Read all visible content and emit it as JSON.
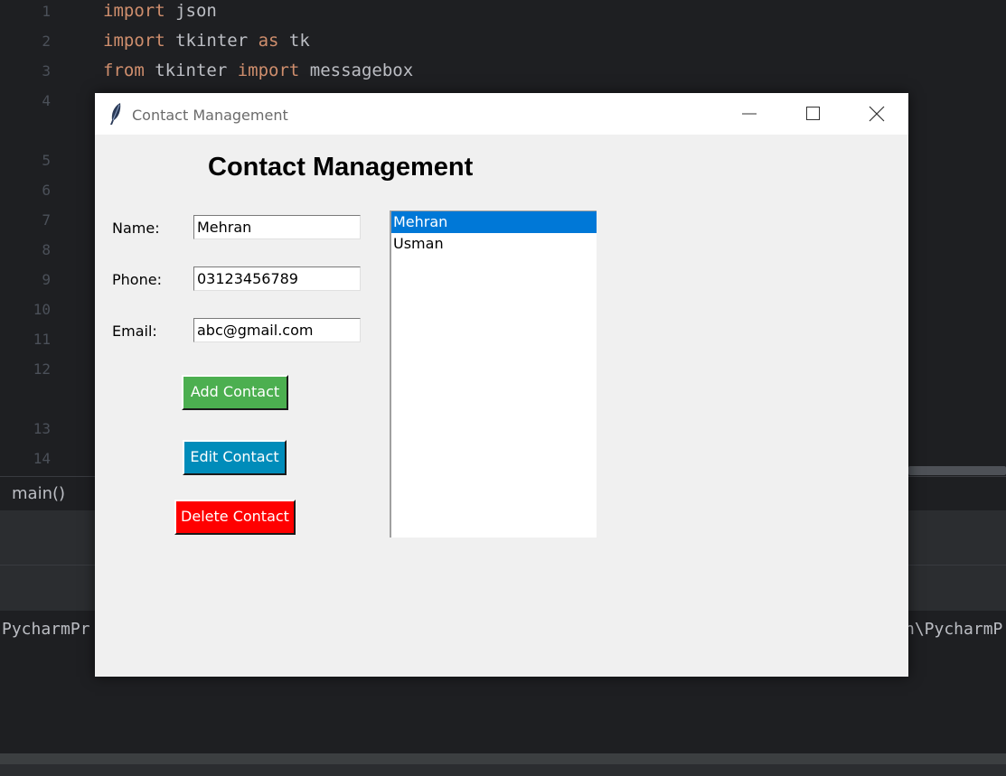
{
  "ide": {
    "line_numbers": [
      "1",
      "2",
      "3",
      "4",
      "5",
      "6",
      "7",
      "8",
      "9",
      "10",
      "11",
      "12",
      "13",
      "14"
    ],
    "code_lines": [
      [
        {
          "t": "import",
          "kw": true
        },
        {
          "t": " json",
          "kw": false
        }
      ],
      [
        {
          "t": "import",
          "kw": true
        },
        {
          "t": " tkinter ",
          "kw": false
        },
        {
          "t": "as",
          "kw": true
        },
        {
          "t": " tk",
          "kw": false
        }
      ],
      [
        {
          "t": "from",
          "kw": true
        },
        {
          "t": " tkinter ",
          "kw": false
        },
        {
          "t": "import",
          "kw": true
        },
        {
          "t": " messagebox",
          "kw": false
        }
      ]
    ],
    "breadcrumb": "main()",
    "console_left": "PycharmPr",
    "console_right": "n\\PycharmP"
  },
  "window": {
    "title": "Contact Management",
    "heading": "Contact Management",
    "form": {
      "name_label": "Name:",
      "name_value": "Mehran",
      "phone_label": "Phone:",
      "phone_value": "03123456789",
      "email_label": "Email:",
      "email_value": "abc@gmail.com"
    },
    "buttons": {
      "add": "Add Contact",
      "edit": "Edit Contact",
      "delete": "Delete Contact"
    },
    "contacts": [
      {
        "name": "Mehran",
        "selected": true
      },
      {
        "name": "Usman",
        "selected": false
      }
    ]
  },
  "colors": {
    "add_button": "#4caf50",
    "edit_button": "#008cba",
    "delete_button": "#ff0000",
    "selection": "#0078d7",
    "keyword": "#cf8e6d"
  }
}
